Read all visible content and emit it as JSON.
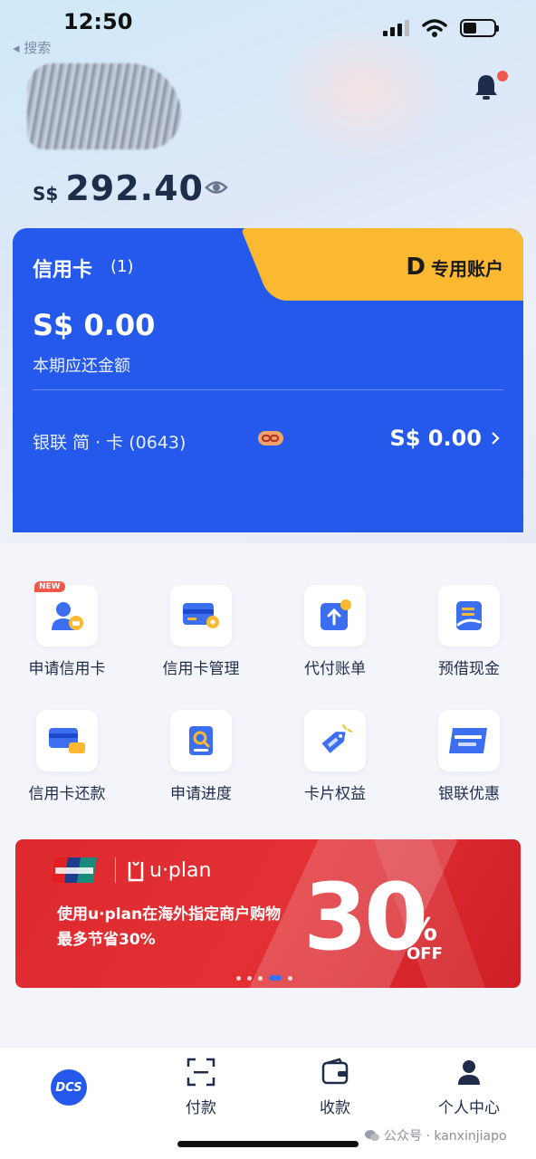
{
  "status_bar": {
    "time": "12:50"
  },
  "nav": {
    "back_search": "◂ 搜索"
  },
  "balance": {
    "currency": "S$",
    "amount": "292.40"
  },
  "card": {
    "title": "信用卡",
    "count": "(1)",
    "tab_icon_letter": "D",
    "tab_label": "专用账户",
    "amount": "S$ 0.00",
    "amount_label": "本期应还金额",
    "card_name": "银联 简 · 卡 (0643)",
    "card_balance": "S$ 0.00",
    "colors": {
      "card_blue": "#2459ec",
      "tab_yellow": "#fbb932"
    }
  },
  "menu": {
    "new_badge": "NEW",
    "items": [
      {
        "label": "申请信用卡",
        "icon": "apply-card-icon"
      },
      {
        "label": "信用卡管理",
        "icon": "card-settings-icon"
      },
      {
        "label": "代付账单",
        "icon": "bill-upload-icon"
      },
      {
        "label": "预借现金",
        "icon": "cash-advance-icon"
      },
      {
        "label": "信用卡还款",
        "icon": "card-repay-icon"
      },
      {
        "label": "申请进度",
        "icon": "progress-doc-icon"
      },
      {
        "label": "卡片权益",
        "icon": "deal-tag-icon"
      },
      {
        "label": "银联优惠",
        "icon": "unionpay-icon"
      }
    ]
  },
  "banner": {
    "logo_text": "UnionPay 银联",
    "uplan": "u·plan",
    "line1": "使用u·plan在海外指定商户购物",
    "line2": "最多节省30%",
    "big_number": "30",
    "percent": "%",
    "off": "OFF",
    "active_dot": 4,
    "dot_count": 5,
    "color": "#de2a2e"
  },
  "tabbar": {
    "home_label": "DCS",
    "items": [
      {
        "label": "付款",
        "icon": "scan-icon"
      },
      {
        "label": "收款",
        "icon": "wallet-icon"
      },
      {
        "label": "个人中心",
        "icon": "person-icon"
      }
    ]
  },
  "watermark": "公众号 · kanxinjiapo"
}
